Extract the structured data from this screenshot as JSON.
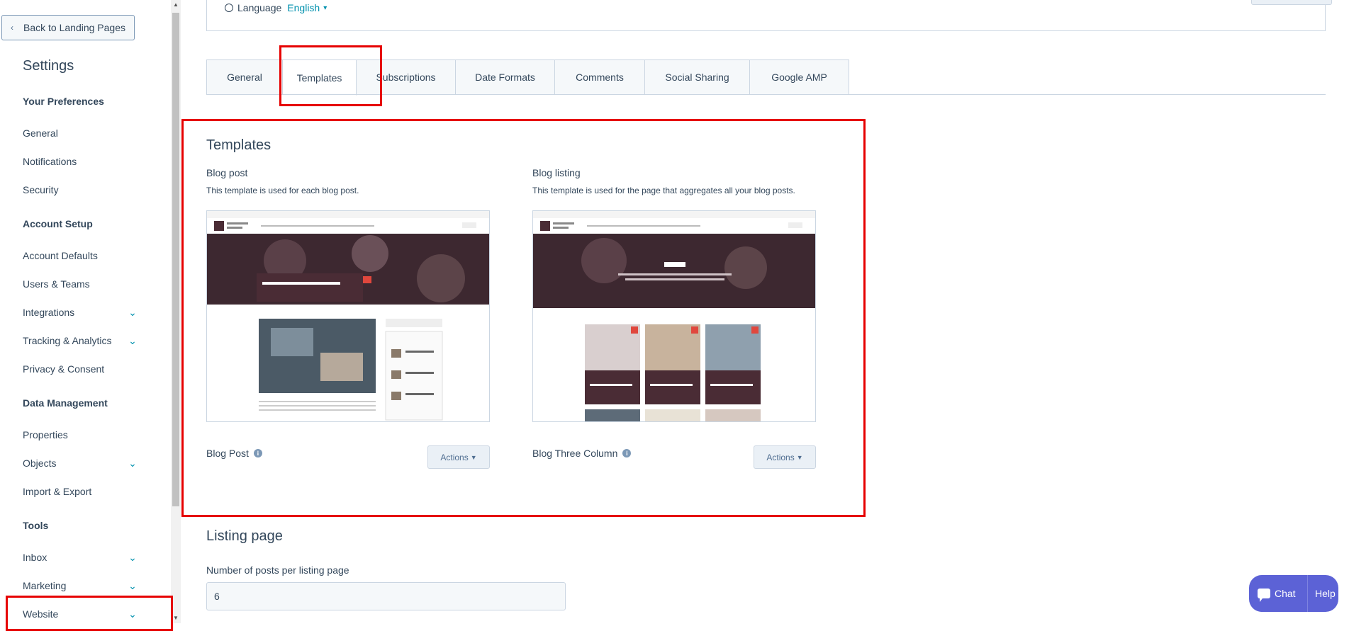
{
  "sidebar": {
    "back_label": "Back to Landing Pages",
    "title": "Settings",
    "sections": {
      "preferences": "Your Preferences",
      "account_setup": "Account Setup",
      "data_management": "Data Management",
      "tools": "Tools"
    },
    "items": {
      "general": "General",
      "notifications": "Notifications",
      "security": "Security",
      "account_defaults": "Account Defaults",
      "users_teams": "Users & Teams",
      "integrations": "Integrations",
      "tracking_analytics": "Tracking & Analytics",
      "privacy_consent": "Privacy & Consent",
      "properties": "Properties",
      "objects": "Objects",
      "import_export": "Import & Export",
      "inbox": "Inbox",
      "marketing": "Marketing",
      "website": "Website"
    }
  },
  "language": {
    "label": "Language",
    "value": "English"
  },
  "tabs": [
    "General",
    "Templates",
    "Subscriptions",
    "Date Formats",
    "Comments",
    "Social Sharing",
    "Google AMP"
  ],
  "active_tab": "Templates",
  "templates": {
    "title": "Templates",
    "blog_post": {
      "heading": "Blog post",
      "description": "This template is used for each blog post.",
      "template_name": "Blog Post",
      "actions_label": "Actions"
    },
    "blog_listing": {
      "heading": "Blog listing",
      "description": "This template is used for the page that aggregates all your blog posts.",
      "template_name": "Blog Three Column",
      "actions_label": "Actions"
    }
  },
  "listing_page": {
    "title": "Listing page",
    "posts_label": "Number of posts per listing page",
    "posts_value": "6"
  },
  "chat_widget": {
    "chat_label": "Chat",
    "help_label": "Help"
  },
  "colors": {
    "accent": "#0091ae",
    "highlight": "#e60000",
    "chat": "#5c62d6"
  }
}
